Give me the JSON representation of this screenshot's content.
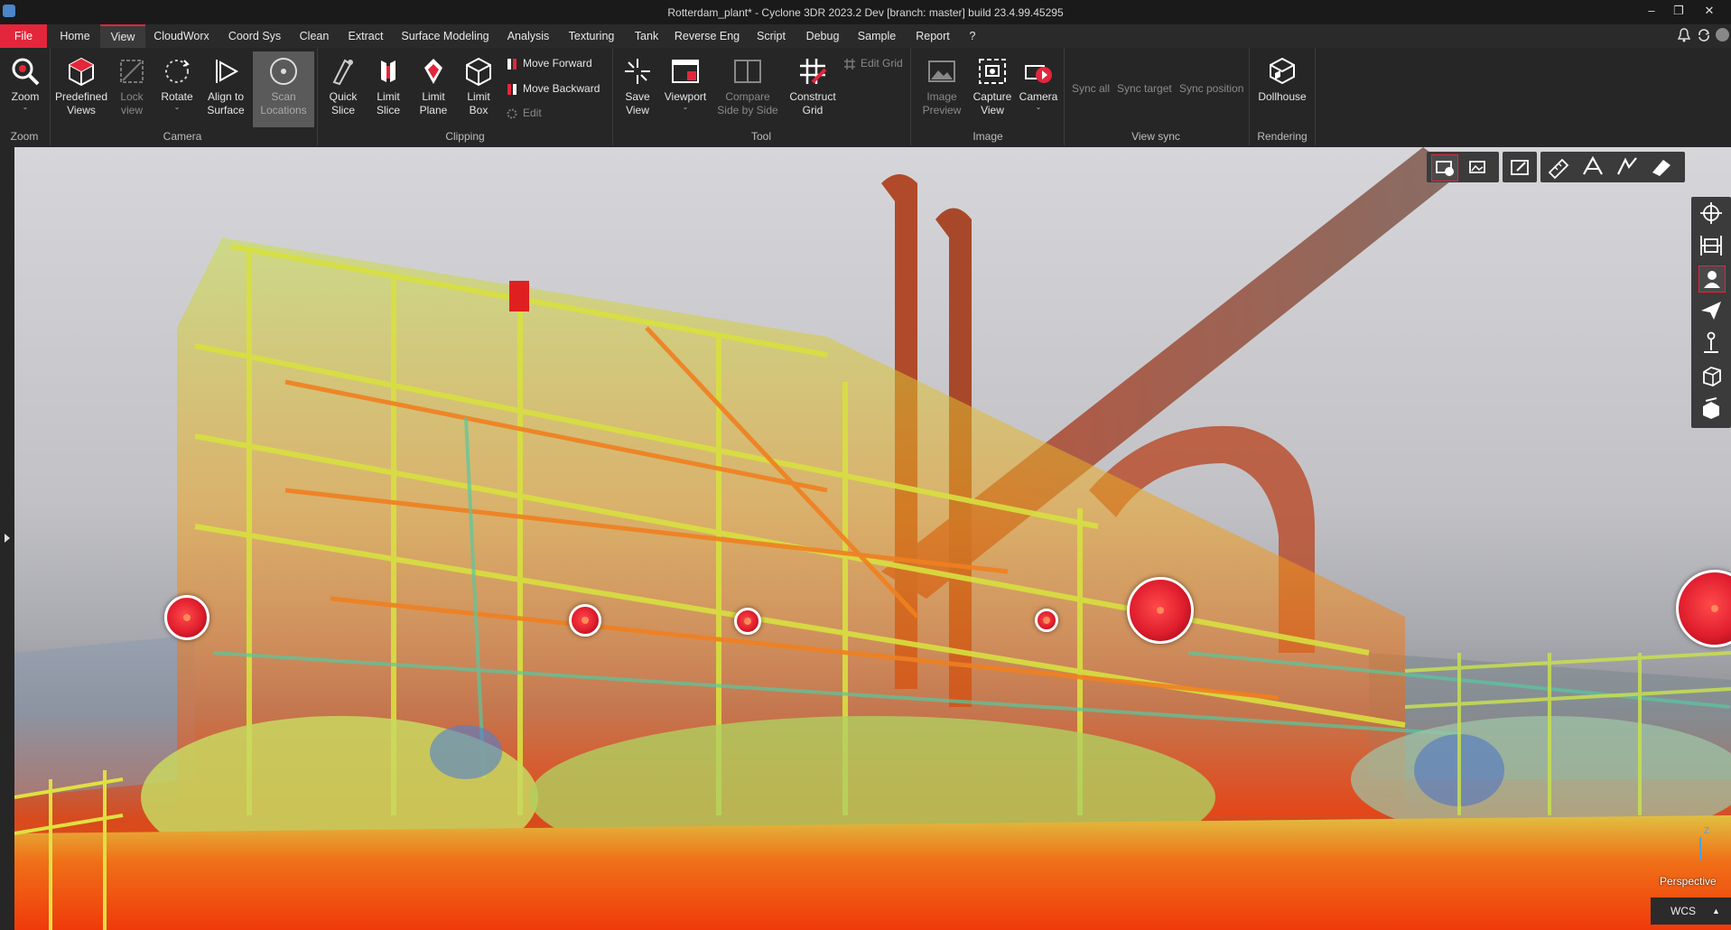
{
  "titlebar": {
    "title": "Rotterdam_plant* - Cyclone 3DR 2023.2 Dev [branch: master] build 23.4.99.45295",
    "minimize": "–",
    "restore": "❐",
    "close": "✕"
  },
  "menu": {
    "items": [
      "File",
      "Home",
      "View",
      "CloudWorx",
      "Coord Sys",
      "Clean",
      "Extract",
      "Surface Modeling",
      "Analysis",
      "Texturing",
      "Tank",
      "Reverse Eng",
      "Script",
      "Debug",
      "Sample",
      "Report",
      "?"
    ],
    "active": "View"
  },
  "ribbon": {
    "zoom": {
      "label": "Zoom",
      "group": "Zoom"
    },
    "camera": {
      "predefined": "Predefined Views",
      "lock": "Lock view",
      "rotate": "Rotate",
      "align": "Align to Surface",
      "scan": "Scan Locations",
      "group": "Camera"
    },
    "clipping": {
      "quick": "Quick Slice",
      "limitslice": "Limit Slice",
      "limitplane": "Limit Plane",
      "limitbox": "Limit Box",
      "forward": "Move Forward",
      "backward": "Move Backward",
      "edit": "Edit",
      "group": "Clipping"
    },
    "tool": {
      "save": "Save View",
      "viewport": "Viewport",
      "compare": "Compare Side by Side",
      "grid": "Construct Grid",
      "editgrid": "Edit Grid",
      "group": "Tool"
    },
    "image": {
      "preview": "Image Preview",
      "capture": "Capture View",
      "camera": "Camera",
      "group": "Image"
    },
    "viewsync": {
      "all": "Sync all",
      "target": "Sync target",
      "position": "Sync position",
      "group": "View sync"
    },
    "rendering": {
      "dollhouse": "Dollhouse",
      "group": "Rendering"
    }
  },
  "viewport": {
    "projection": "Perspective",
    "coord_system": "WCS",
    "axis_label": "Z"
  },
  "colors": {
    "accent": "#e3263b",
    "ribbon_bg": "#262626",
    "menubar_bg": "#2a2a2a"
  }
}
